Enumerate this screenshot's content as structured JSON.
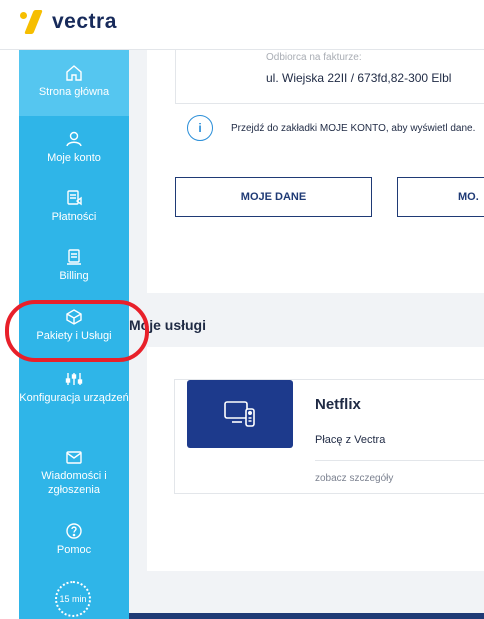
{
  "brand": {
    "name": "vectra"
  },
  "sidebar": {
    "items": [
      {
        "label": "Strona główna",
        "icon": "home-icon",
        "active": true
      },
      {
        "label": "Moje konto",
        "icon": "user-icon",
        "active": false
      },
      {
        "label": "Płatności",
        "icon": "payments-icon",
        "active": false
      },
      {
        "label": "Billing",
        "icon": "billing-icon",
        "active": false
      },
      {
        "label": "Pakiety i Usługi",
        "icon": "package-icon",
        "active": false
      },
      {
        "label": "Konfiguracja urządzeń",
        "icon": "sliders-icon",
        "active": false
      },
      {
        "label": "Wiadomości i zgłoszenia",
        "icon": "mail-icon",
        "active": false
      },
      {
        "label": "Pomoc",
        "icon": "help-icon",
        "active": false
      }
    ],
    "timer": "15 min"
  },
  "invoice": {
    "label": "Odbiorca na fakturze:",
    "address": "ul. Wiejska 22II / 673fd,82-300 Elbl"
  },
  "info": {
    "text": "Przejdź do zakładki MOJE KONTO, aby wyświetl dane."
  },
  "buttons": {
    "my_data": "MOJE DANE",
    "second": "MO."
  },
  "services": {
    "title": "Moje usługi",
    "items": [
      {
        "name": "Netflix",
        "subtitle": "Płacę z Vectra",
        "details_link": "zobacz szczegóły",
        "icon": "tv-remote-icon"
      }
    ]
  },
  "colors": {
    "sidebar": "#2fb5e8",
    "brand_yellow": "#f6be00",
    "navy": "#1d3a8c",
    "annotation": "#e8202a"
  }
}
